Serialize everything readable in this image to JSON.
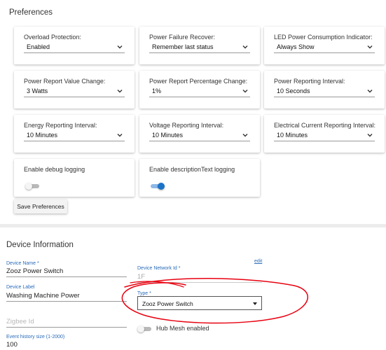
{
  "preferences": {
    "title": "Preferences",
    "cards": [
      {
        "label": "Overload Protection:",
        "value": "Enabled"
      },
      {
        "label": "Power Failure Recover:",
        "value": "Remember last status"
      },
      {
        "label": "LED Power Consumption Indicator:",
        "value": "Always Show"
      },
      {
        "label": "Power Report Value Change:",
        "value": "3 Watts"
      },
      {
        "label": "Power Report Percentage Change:",
        "value": "1%"
      },
      {
        "label": "Power Reporting Interval:",
        "value": "10 Seconds"
      },
      {
        "label": "Energy Reporting Interval:",
        "value": "10 Minutes"
      },
      {
        "label": "Voltage Reporting Interval:",
        "value": "10 Minutes"
      },
      {
        "label": "Electrical Current Reporting Interval:",
        "value": "10 Minutes"
      }
    ],
    "toggles": [
      {
        "label": "Enable debug logging",
        "on": false
      },
      {
        "label": "Enable descriptionText logging",
        "on": true
      }
    ],
    "save_button": "Save Preferences"
  },
  "device": {
    "title": "Device Information",
    "name_label": "Device Name *",
    "name_value": "Zooz Power Switch",
    "label_label": "Device Label",
    "label_value": "Washing Machine Power",
    "zigbee_placeholder": "Zigbee Id",
    "history_label": "Event history size (1-2000)",
    "history_value": "100",
    "edit_link": "edit",
    "network_id_label": "Device Network Id *",
    "network_id_value": "1F",
    "type_label": "Type *",
    "type_value": "Zooz Power Switch",
    "hub_mesh_label": "Hub Mesh enabled",
    "hub_mesh_on": false
  },
  "colors": {
    "accent": "#1a73c8",
    "field_label": "#2a6bb8",
    "annotation": "#e8000f"
  },
  "icons": [
    "chevron-down-icon",
    "caret-down-icon"
  ]
}
